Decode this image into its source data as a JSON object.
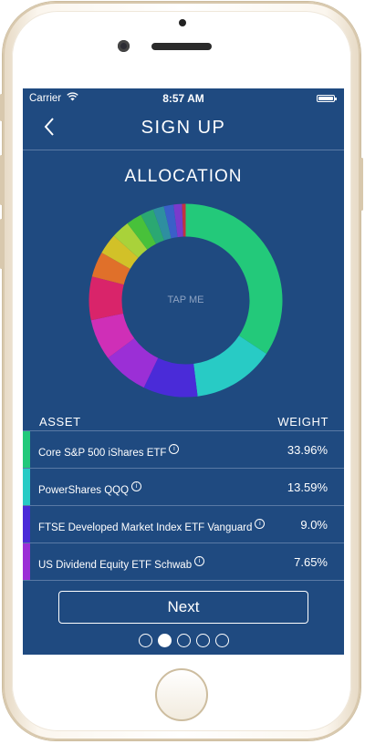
{
  "status_bar": {
    "carrier": "Carrier",
    "time": "8:57 AM"
  },
  "nav": {
    "title": "SIGN UP"
  },
  "allocation": {
    "title": "ALLOCATION",
    "center_label": "TAP ME",
    "slices": [
      {
        "color": "#23c97a",
        "value": 33.96
      },
      {
        "color": "#28cbc5",
        "value": 13.59
      },
      {
        "color": "#4a2bd8",
        "value": 9.0
      },
      {
        "color": "#9b2fd6",
        "value": 7.65
      },
      {
        "color": "#cf2fb7",
        "value": 6.8
      },
      {
        "color": "#d9246a",
        "value": 7.2
      },
      {
        "color": "#e0702a",
        "value": 4.2
      },
      {
        "color": "#d2c128",
        "value": 3.4
      },
      {
        "color": "#a9d23a",
        "value": 3.0
      },
      {
        "color": "#48c13a",
        "value": 2.6
      },
      {
        "color": "#2ba872",
        "value": 2.2
      },
      {
        "color": "#2e8fa0",
        "value": 1.8
      },
      {
        "color": "#3a5fc8",
        "value": 1.6
      },
      {
        "color": "#7a3acc",
        "value": 1.4
      },
      {
        "color": "#c23340",
        "value": 0.6
      }
    ]
  },
  "table": {
    "col_asset": "ASSET",
    "col_weight": "WEIGHT",
    "rows": [
      {
        "name": "Core S&P 500 iShares ETF",
        "weight": "33.96%",
        "color": "#23c97a"
      },
      {
        "name": "PowerShares QQQ",
        "weight": "13.59%",
        "color": "#28cbc5"
      },
      {
        "name": "FTSE Developed Market Index ETF Vanguard",
        "weight": "9.0%",
        "color": "#4a2bd8"
      },
      {
        "name": "US Dividend Equity ETF Schwab",
        "weight": "7.65%",
        "color": "#9b2fd6"
      }
    ],
    "info_glyph": "i"
  },
  "footer": {
    "next_label": "Next",
    "page_count": 5,
    "active_page": 2
  },
  "icons": [
    "back-chevron-icon",
    "wifi-icon",
    "battery-icon",
    "info-icon"
  ]
}
